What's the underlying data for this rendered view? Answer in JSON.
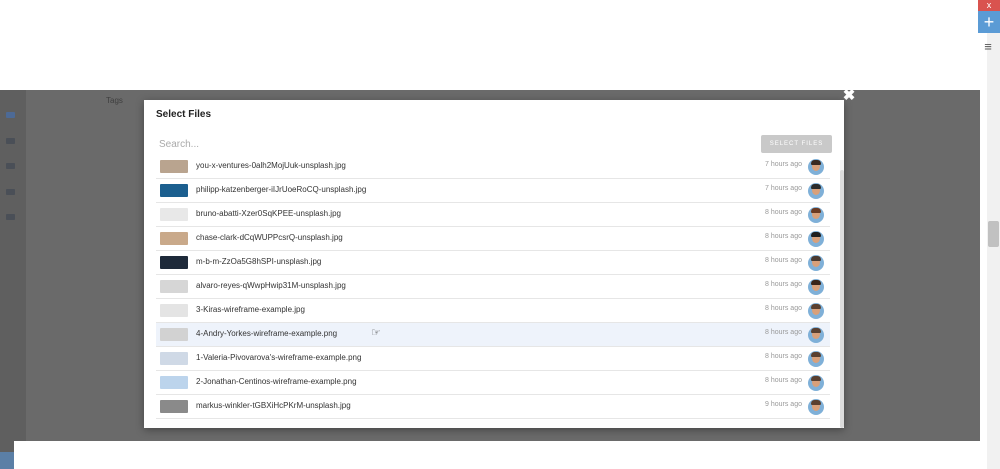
{
  "background": {
    "tags_label": "Tags"
  },
  "floating": {
    "close_glyph": "x",
    "add_glyph": "+",
    "menu_glyph": "≡"
  },
  "modal": {
    "title": "Select Files",
    "close_glyph": "✖",
    "search_placeholder": "Search...",
    "select_button": "SELECT FILES",
    "files": [
      {
        "name": "you-x-ventures-0alh2MojUuk-unsplash.jpg",
        "time": "7 hours ago",
        "thumb_color": "#b9a48f",
        "hair": "#3a2a20",
        "hover": false
      },
      {
        "name": "philipp-katzenberger-iIJrUoeRoCQ-unsplash.jpg",
        "time": "7 hours ago",
        "thumb_color": "#1b5f8f",
        "hair": "#2b2b2b",
        "hover": false
      },
      {
        "name": "bruno-abatti-Xzer0SqKPEE-unsplash.jpg",
        "time": "8 hours ago",
        "thumb_color": "#e8e8e8",
        "hair": "#6b3a22",
        "hover": false
      },
      {
        "name": "chase-clark-dCqWUPPcsrQ-unsplash.jpg",
        "time": "8 hours ago",
        "thumb_color": "#c9a98a",
        "hair": "#1f1f1f",
        "hover": false
      },
      {
        "name": "m-b-m-ZzOa5G8hSPI-unsplash.jpg",
        "time": "8 hours ago",
        "thumb_color": "#1e2a3a",
        "hair": "#4a3a30",
        "hover": false
      },
      {
        "name": "alvaro-reyes-qWwpHwip31M-unsplash.jpg",
        "time": "8 hours ago",
        "thumb_color": "#d6d6d6",
        "hair": "#3a2418",
        "hover": false
      },
      {
        "name": "3-Kiras-wireframe-example.jpg",
        "time": "8 hours ago",
        "thumb_color": "#e4e4e4",
        "hair": "#5a4030",
        "hover": false
      },
      {
        "name": "4-Andry-Yorkes-wireframe-example.png",
        "time": "8 hours ago",
        "thumb_color": "#d2d2d2",
        "hair": "#5a4030",
        "hover": true
      },
      {
        "name": "1-Valeria-Pivovarova's-wireframe-example.png",
        "time": "8 hours ago",
        "thumb_color": "#cfd9e6",
        "hair": "#5a4030",
        "hover": false
      },
      {
        "name": "2-Jonathan-Centinos-wireframe-example.png",
        "time": "8 hours ago",
        "thumb_color": "#bcd4ec",
        "hair": "#5a4030",
        "hover": false
      },
      {
        "name": "markus-winkler-tGBXiHcPKrM-unsplash.jpg",
        "time": "9 hours ago",
        "thumb_color": "#8a8a8a",
        "hair": "#5a4030",
        "hover": false
      }
    ]
  }
}
